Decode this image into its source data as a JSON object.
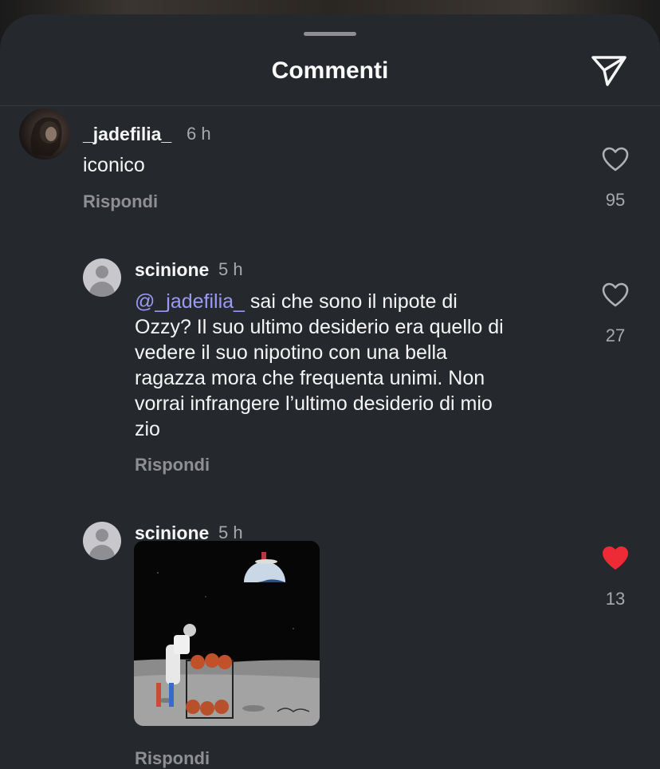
{
  "header": {
    "title": "Commenti"
  },
  "icons": {
    "share": "paper-plane-icon",
    "like": "heart-icon",
    "liked": "heart-filled-icon"
  },
  "colors": {
    "background": "#25282d",
    "mention": "#9b9bf5",
    "liked_heart": "#ee2a37"
  },
  "comments": [
    {
      "username": "_jadefilia_",
      "time": "6 h",
      "text": "iconico",
      "reply_label": "Rispondi",
      "likes": "95",
      "liked": false
    },
    {
      "username": "scinione",
      "time": "5 h",
      "mention": "@_jadefilia_",
      "text_lines": [
        " sai che sono il nipote di",
        "Ozzy? Il suo ultimo desiderio era quello di",
        "vedere il suo nipotino con una bella",
        "ragazza mora che frequenta unimi. Non",
        "vorrai infrangere l’ultimo desiderio di mio",
        "zio"
      ],
      "reply_label": "Rispondi",
      "likes": "27",
      "liked": false
    },
    {
      "username": "scinione",
      "time": "5 h",
      "attachment": "gif",
      "reply_label": "Rispondi",
      "likes": "13",
      "liked": true
    }
  ]
}
